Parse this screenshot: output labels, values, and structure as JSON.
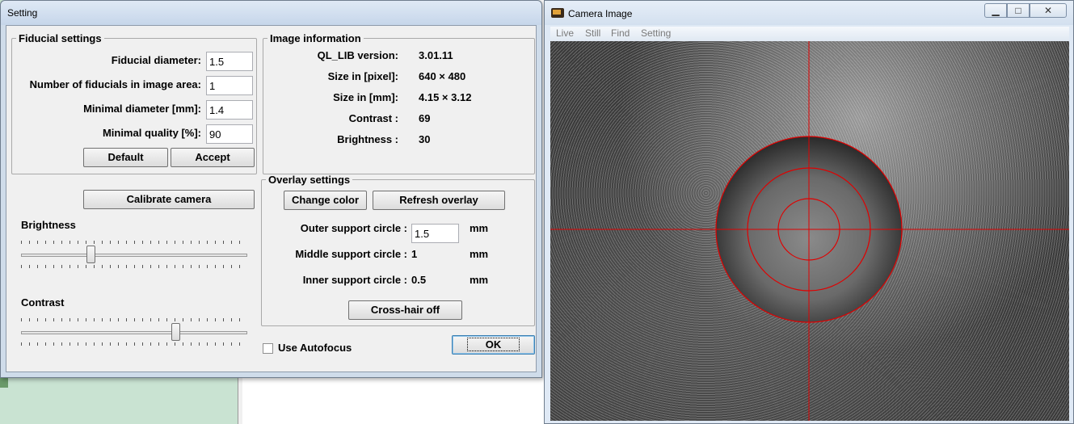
{
  "setting_window": {
    "title": "Setting",
    "fiducial": {
      "legend": "Fiducial settings",
      "diameter_label": "Fiducial diameter:",
      "diameter_value": "1.5",
      "count_label": "Number of fiducials in image area:",
      "count_value": "1",
      "min_diameter_label": "Minimal diameter [mm]:",
      "min_diameter_value": "1.4",
      "min_quality_label": "Minimal quality [%]:",
      "min_quality_value": "90",
      "default_button": "Default",
      "accept_button": "Accept"
    },
    "image_info": {
      "legend": "Image information",
      "rows": [
        {
          "label": "QL_LIB version:",
          "value": "3.01.11"
        },
        {
          "label": "Size in [pixel]:",
          "value": "640 × 480"
        },
        {
          "label": "Size in [mm]:",
          "value": "4.15 × 3.12"
        },
        {
          "label": "Contrast :",
          "value": "69"
        },
        {
          "label": "Brightness :",
          "value": "30"
        }
      ]
    },
    "calibrate_button": "Calibrate camera",
    "brightness_label": "Brightness",
    "brightness_level": 0.3,
    "contrast_label": "Contrast",
    "contrast_level": 0.69,
    "overlay": {
      "legend": "Overlay settings",
      "change_color_button": "Change color",
      "refresh_button": "Refresh overlay",
      "outer_label": "Outer support circle :",
      "outer_value": "1.5",
      "middle_label": "Middle support circle :",
      "middle_value": "1",
      "inner_label": "Inner support circle :",
      "inner_value": "0.5",
      "unit": "mm",
      "crosshair_button": "Cross-hair off"
    },
    "autofocus_label": "Use Autofocus",
    "autofocus_checked": false,
    "ok_button": "OK"
  },
  "camera_window": {
    "title": "Camera Image",
    "menu": [
      "Live",
      "Still",
      "Find",
      "Setting"
    ],
    "overlay_color": "#e00000"
  }
}
